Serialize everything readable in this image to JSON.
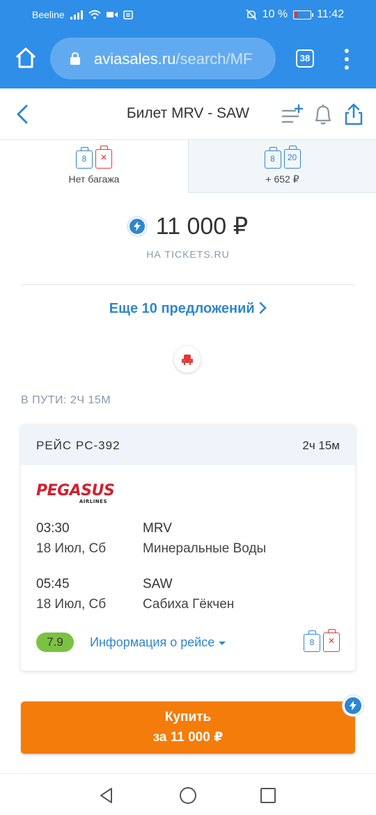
{
  "status_bar": {
    "carrier": "Beeline",
    "battery": "10 %",
    "time": "11:42"
  },
  "browser": {
    "url_host": "aviasales.ru",
    "url_path": "/search/MF",
    "tab_count": "38"
  },
  "header": {
    "title": "Билет MRV - SAW"
  },
  "baggage_tabs": [
    {
      "icons": [
        "8",
        "x"
      ],
      "label": "Нет багажа"
    },
    {
      "icons": [
        "8",
        "20"
      ],
      "label": "+ 652 ₽"
    }
  ],
  "offer": {
    "price": "11 000 ₽",
    "source": "НА TICKETS.RU",
    "more_offers": "Еще 10 предложений"
  },
  "duration_caption": "В ПУТИ: 2Ч 15М",
  "flight": {
    "number": "РЕЙС PC-392",
    "duration": "2ч 15м",
    "airline_logo": "PEGASUS",
    "airline_logo_sub": "AIRLINES",
    "departure": {
      "time": "03:30",
      "date": "18 Июл, Сб",
      "code": "MRV",
      "city": "Минеральные Воды"
    },
    "arrival": {
      "time": "05:45",
      "date": "18 Июл, Сб",
      "code": "SAW",
      "city": "Сабиха Гёкчен"
    },
    "rating": "7.9",
    "info_link": "Информация о рейсе",
    "bag_hand": "8"
  },
  "buy_button": {
    "line1": "Купить",
    "line2": "за 11 000 ₽"
  },
  "colors": {
    "brand_blue": "#2f8ee8",
    "link_blue": "#2e86d1",
    "buy_orange": "#f47c0a",
    "rating_green": "#7cc242",
    "no_bag_red": "#e53935"
  },
  "icons": [
    "home-icon",
    "lock-icon",
    "tabs-icon",
    "overflow-menu-icon",
    "back-arrow-icon",
    "filter-icon",
    "bell-icon",
    "share-icon",
    "lightning-icon",
    "seat-icon",
    "back-nav-icon",
    "home-nav-icon",
    "recents-nav-icon"
  ]
}
